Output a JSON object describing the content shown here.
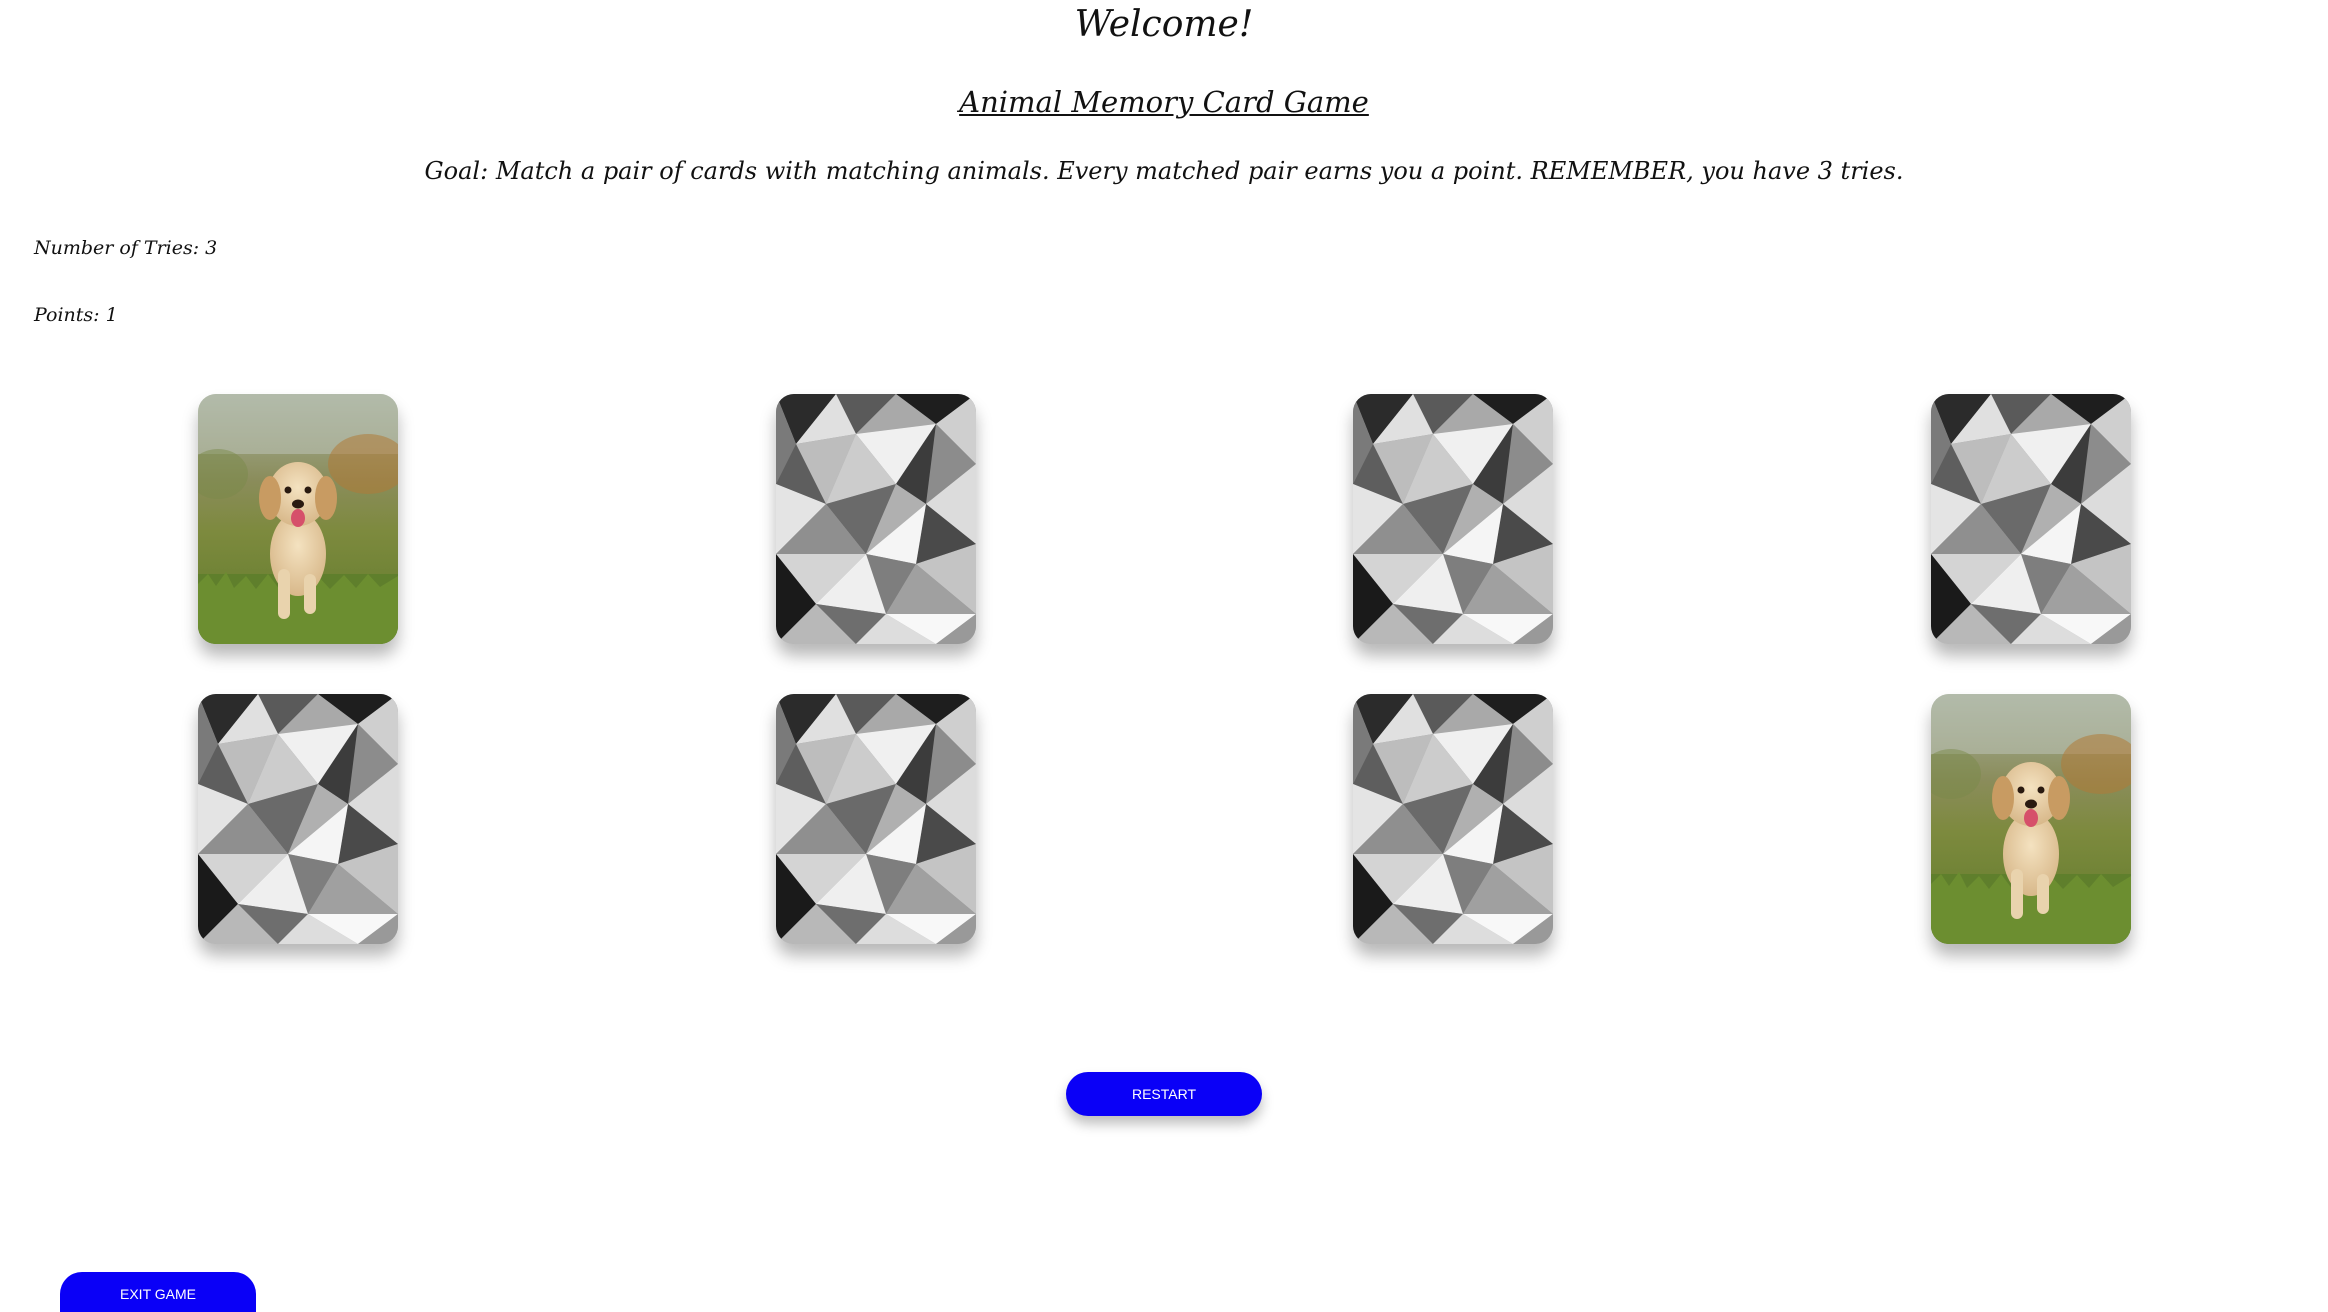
{
  "header": {
    "welcome": "Welcome!",
    "game_title": "Animal Memory Card Game",
    "goal": "Goal: Match a pair of cards with matching animals. Every matched pair earns you a point. REMEMBER, you have 3 tries."
  },
  "stats": {
    "tries_label": "Number of Tries: 3",
    "points_label": "Points: 1"
  },
  "cards": [
    {
      "state": "face-up",
      "animal": "puppy"
    },
    {
      "state": "face-down",
      "animal": ""
    },
    {
      "state": "face-down",
      "animal": ""
    },
    {
      "state": "face-down",
      "animal": ""
    },
    {
      "state": "face-down",
      "animal": ""
    },
    {
      "state": "face-down",
      "animal": ""
    },
    {
      "state": "face-down",
      "animal": ""
    },
    {
      "state": "face-up",
      "animal": "puppy"
    }
  ],
  "buttons": {
    "restart": "RESTART",
    "exit": "EXIT GAME"
  },
  "colors": {
    "button_bg": "#0a00f7",
    "button_text": "#ffffff"
  }
}
